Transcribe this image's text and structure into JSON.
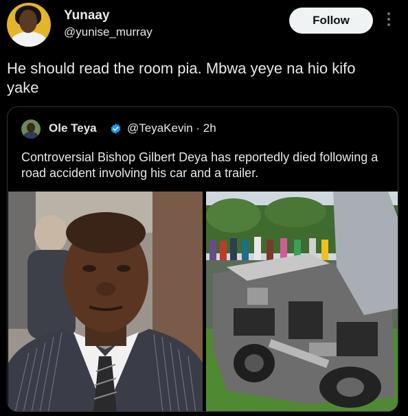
{
  "post": {
    "author_name": "Yunaay",
    "author_handle": "@yunise_murray",
    "follow_label": "Follow",
    "text": "He should read the room pia. Mbwa yeye na hio kifo yake"
  },
  "quoted_post": {
    "author_name": "Ole Teya",
    "author_handle_time": "@TeyaKevin · 2h",
    "text": "Controversial Bishop Gilbert Deya has reportedly died following a road accident involving his car and a trailer."
  },
  "icons": {
    "more": "more-dots-icon",
    "verified": "verified-badge-icon"
  },
  "colors": {
    "background": "#000000",
    "text": "#e7e9ea",
    "muted": "#71767b",
    "follow_bg": "#eff3f4",
    "verified": "#1d9bf0",
    "border": "#2f3336"
  }
}
